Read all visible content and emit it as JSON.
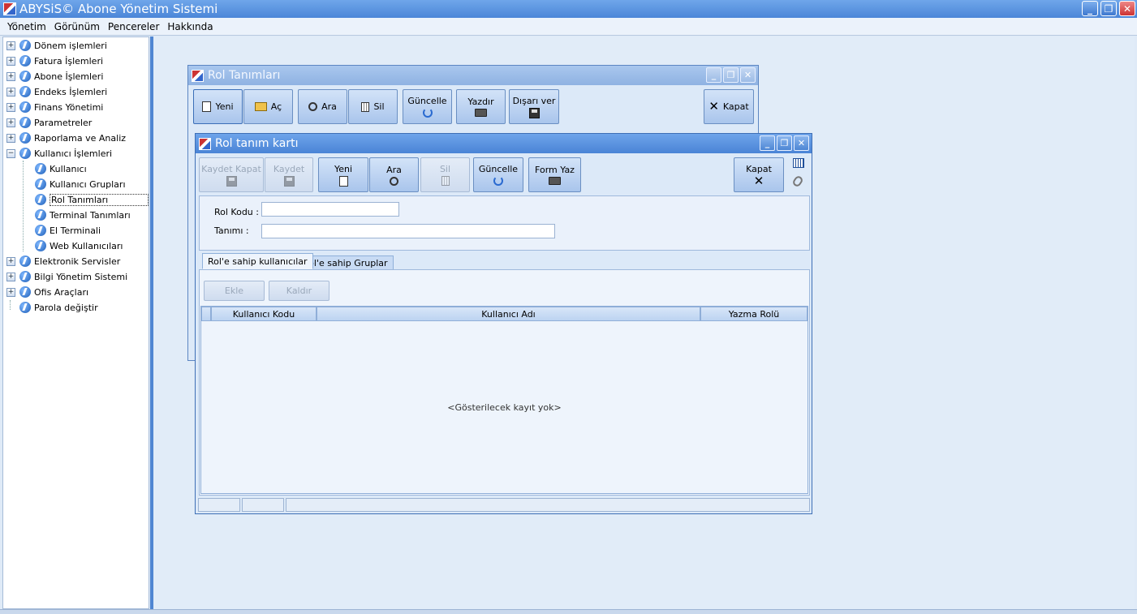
{
  "app": {
    "title": "ABYSiS© Abone Yönetim Sistemi"
  },
  "window_controls": {
    "minimize": "_",
    "restore": "❐",
    "close": "✕"
  },
  "menu": [
    "Yönetim",
    "Görünüm",
    "Pencereler",
    "Hakkında"
  ],
  "tree": {
    "expand_symbol": "+",
    "collapse_symbol": "−",
    "items": [
      {
        "label": "Dönem işlemleri"
      },
      {
        "label": "Fatura İşlemleri"
      },
      {
        "label": "Abone İşlemleri"
      },
      {
        "label": "Endeks İşlemleri"
      },
      {
        "label": "Finans Yönetimi"
      },
      {
        "label": "Parametreler"
      },
      {
        "label": "Raporlama ve Analiz"
      },
      {
        "label": "Kullanıcı İşlemleri"
      },
      {
        "label": "Kullanıcı"
      },
      {
        "label": "Kullanıcı Grupları"
      },
      {
        "label": "Rol Tanımları"
      },
      {
        "label": "Terminal Tanımları"
      },
      {
        "label": "El Terminali"
      },
      {
        "label": "Web Kullanıcıları"
      },
      {
        "label": "Elektronik Servisler"
      },
      {
        "label": "Bilgi Yönetim Sistemi"
      },
      {
        "label": "Ofis Araçları"
      },
      {
        "label": "Parola değiştir"
      }
    ]
  },
  "rol_tanimlari": {
    "title": "Rol Tanımları",
    "toolbar": {
      "yeni": "Yeni",
      "ac": "Aç",
      "ara": "Ara",
      "sil": "Sil",
      "guncelle": "Güncelle",
      "yazdir": "Yazdır",
      "disari_ver": "Dışarı ver",
      "kapat": "Kapat"
    }
  },
  "rol_kart": {
    "title": "Rol tanım kartı",
    "toolbar": {
      "kaydet_kapat": "Kaydet Kapat",
      "kaydet": "Kaydet",
      "yeni": "Yeni",
      "ara": "Ara",
      "sil": "Sil",
      "guncelle": "Güncelle",
      "form_yaz": "Form Yaz",
      "kapat": "Kapat"
    },
    "fields": {
      "rol_kodu_label": "Rol Kodu :",
      "rol_kodu_value": "",
      "tanimi_label": "Tanımı :",
      "tanimi_value": ""
    },
    "tabs": [
      "Rol'e sahip kullanıcılar",
      "Rol'e sahip Gruplar"
    ],
    "buttons": {
      "ekle": "Ekle",
      "kaldir": "Kaldır"
    },
    "grid": {
      "columns": [
        "Kullanıcı Kodu",
        "Kullanıcı Adı",
        "Yazma Rolü"
      ],
      "empty_text": "<Gösterilecek kayıt yok>"
    }
  }
}
